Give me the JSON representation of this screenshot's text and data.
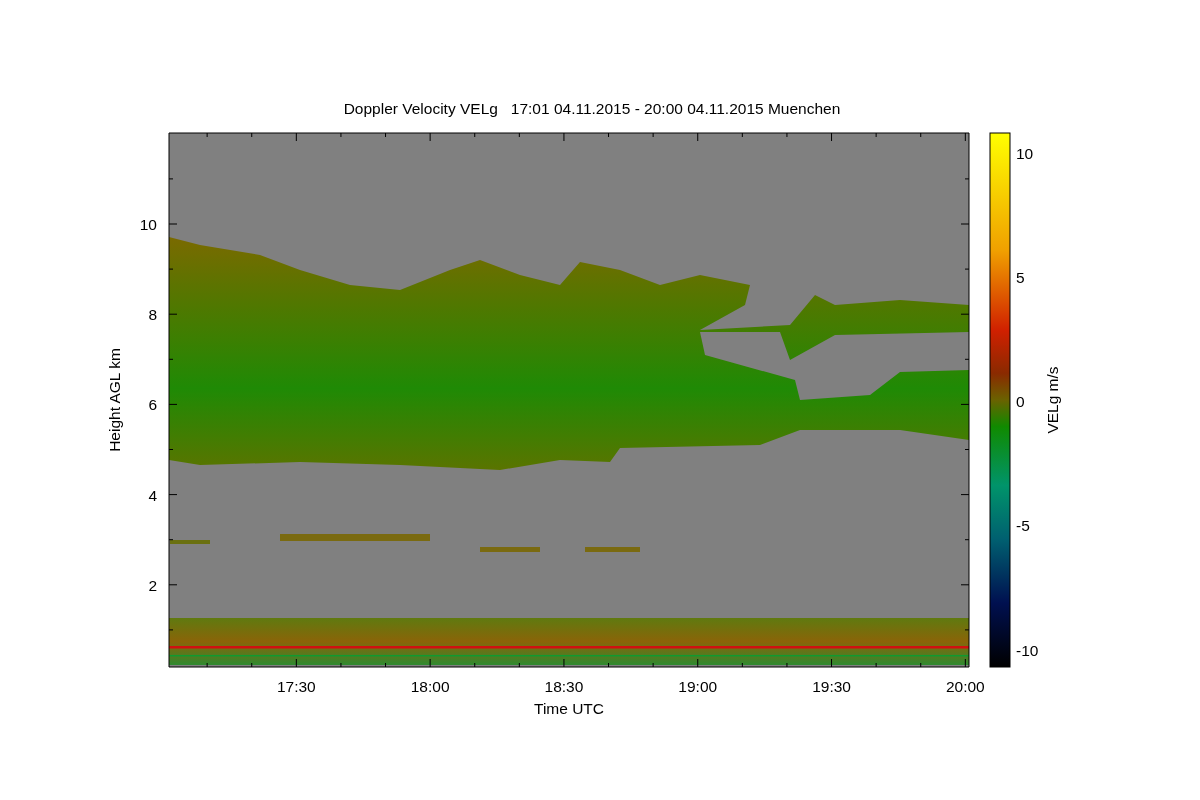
{
  "title": "Doppler Velocity VELg   17:01 04.11.2015 - 20:00 04.11.2015 Muenchen",
  "plot": {
    "ylabel": "Height AGL km",
    "yticks": [
      "10",
      "8",
      "6",
      "4",
      "2"
    ],
    "xlabel": "Time UTC",
    "xticks": [
      "17:30",
      "18:00",
      "18:30",
      "19:00",
      "19:30",
      "20:00"
    ]
  },
  "colorbar": {
    "label": "VELg m/s",
    "ticks": [
      "10",
      "5",
      "0",
      "-5",
      "-10"
    ]
  }
}
